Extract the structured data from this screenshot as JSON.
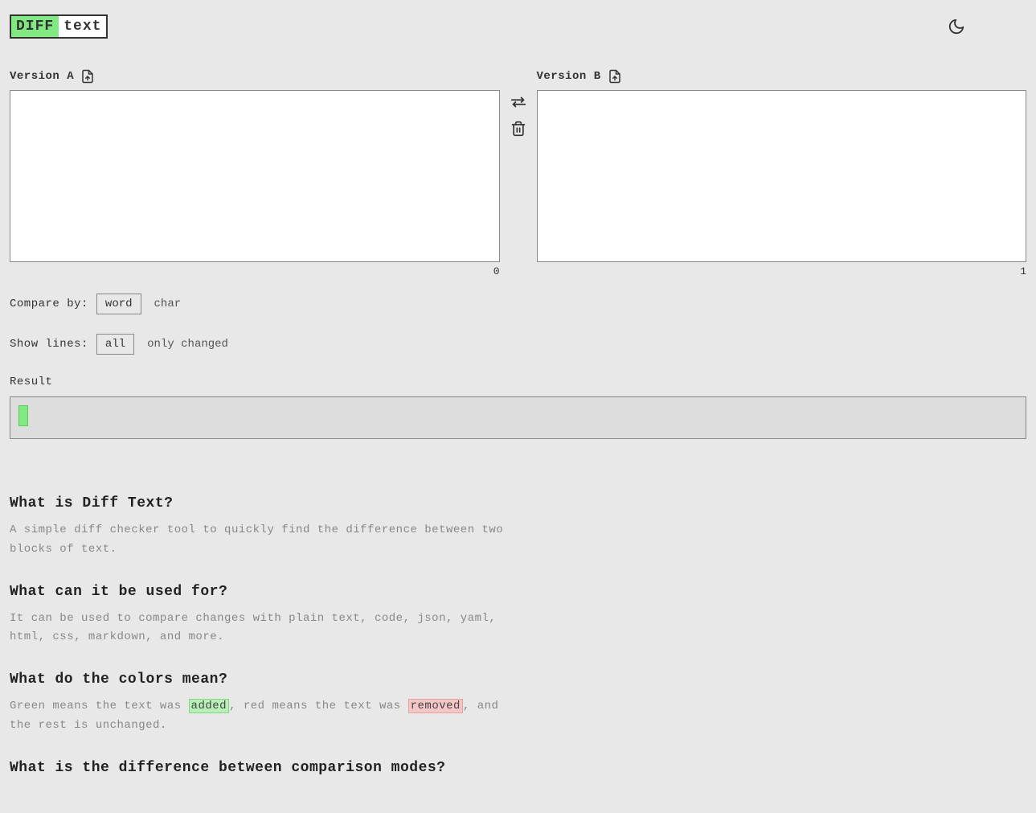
{
  "logo": {
    "part1": "DIFF",
    "part2": "text"
  },
  "versionA": {
    "label": "Version A",
    "value": "",
    "count": "0"
  },
  "versionB": {
    "label": "Version B",
    "value": "",
    "count": "1"
  },
  "compareBy": {
    "label": "Compare by:",
    "opt_word": "word",
    "opt_char": "char"
  },
  "showLines": {
    "label": "Show lines:",
    "opt_all": "all",
    "opt_changed": "only changed"
  },
  "result": {
    "label": "Result"
  },
  "faq": {
    "q1": "What is Diff Text?",
    "a1": "A simple diff checker tool to quickly find the difference between two blocks of text.",
    "q2": "What can it be used for?",
    "a2": "It can be used to compare changes with plain text, code, json, yaml, html, css, markdown, and more.",
    "q3": "What do the colors mean?",
    "a3_pre": "Green means the text was ",
    "a3_added": "added",
    "a3_mid": ", red means the text was ",
    "a3_removed": "removed",
    "a3_post": ", and the rest is unchanged.",
    "q4": "What is the difference between comparison modes?"
  }
}
